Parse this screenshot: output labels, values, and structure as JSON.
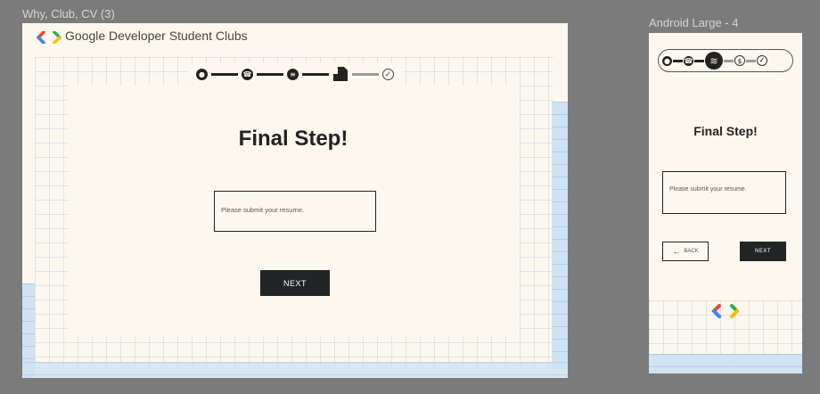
{
  "desktop": {
    "frame_label": "Why, Club, CV (3)",
    "brand_text": "Google Developer Student Clubs",
    "heading": "Final Step!",
    "resume_placeholder": "Please submit your resume.",
    "next_label": "NEXT"
  },
  "mobile": {
    "frame_label": "Android Large - 4",
    "heading": "Final Step!",
    "resume_placeholder": "Please submit your resume.",
    "back_label": "BACK",
    "next_label": "NEXT"
  },
  "colors": {
    "blue": "#4285F4",
    "red": "#EA4335",
    "yellow": "#FBBC04",
    "green": "#34A853",
    "dark": "#222426"
  },
  "icons": [
    "person-icon",
    "phone-icon",
    "layers-icon",
    "document-icon",
    "check-circle-icon",
    "coin-icon",
    "back-arrow-icon",
    "gdsc-logo-icon"
  ]
}
